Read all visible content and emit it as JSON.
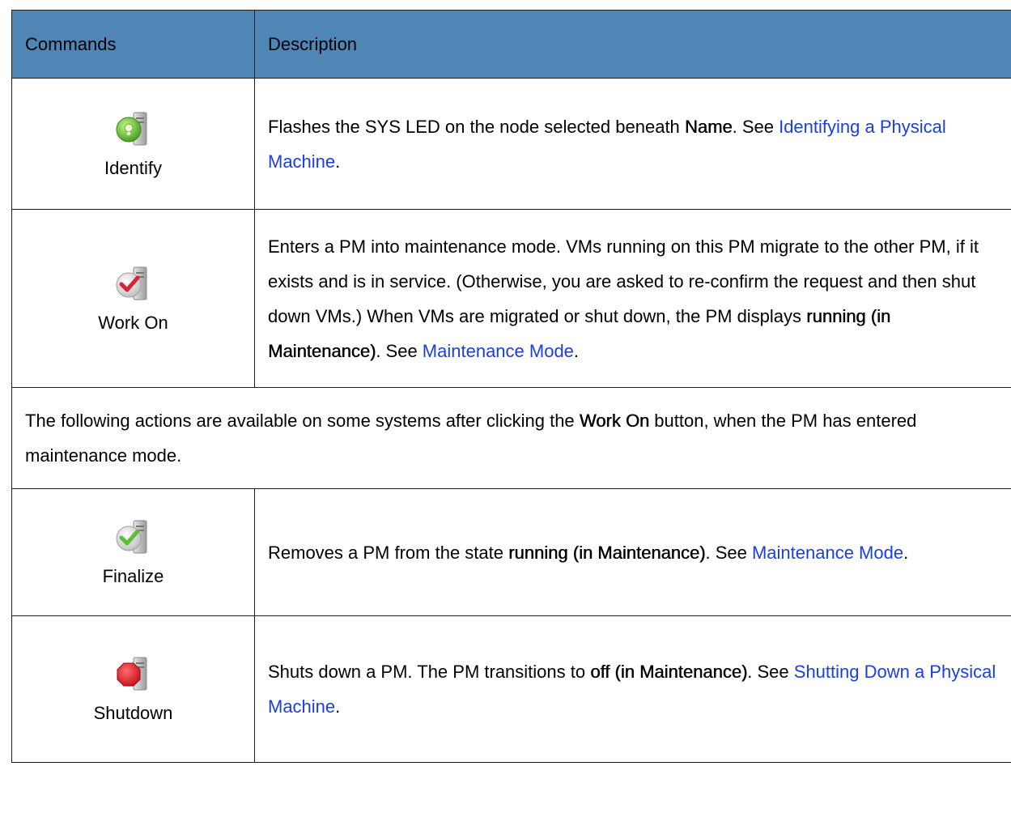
{
  "header": {
    "commands": "Commands",
    "description": "Description"
  },
  "rows": [
    {
      "command": "Identify",
      "icon": "identify-icon",
      "parts": [
        {
          "type": "text",
          "value": "Flashes the SYS LED on the node selected beneath "
        },
        {
          "type": "bold",
          "value": "Name"
        },
        {
          "type": "text",
          "value": ". See "
        },
        {
          "type": "link",
          "value": "Identifying a Physical Machine"
        },
        {
          "type": "text",
          "value": "."
        }
      ]
    },
    {
      "command": "Work On",
      "icon": "work-on-icon",
      "parts": [
        {
          "type": "text",
          "value": "Enters a PM into maintenance mode. VMs running on this PM migrate to the other PM, if it exists and is in service. (Otherwise, you are asked to re-confirm the request and then shut down VMs.) When VMs are migrated or shut down, the PM displays "
        },
        {
          "type": "bold",
          "value": "running (in Maintenance)"
        },
        {
          "type": "text",
          "value": ". See "
        },
        {
          "type": "link",
          "value": "Maintenance Mode"
        },
        {
          "type": "text",
          "value": "."
        }
      ]
    }
  ],
  "note": {
    "parts": [
      {
        "type": "text",
        "value": "The following actions are available on some systems after clicking the "
      },
      {
        "type": "bold",
        "value": "Work On"
      },
      {
        "type": "text",
        "value": " button, when the PM has entered maintenance mode."
      }
    ]
  },
  "rows_after": [
    {
      "command": "Finalize",
      "icon": "finalize-icon",
      "parts": [
        {
          "type": "text",
          "value": "Removes a PM from the state "
        },
        {
          "type": "bold",
          "value": "running (in Maintenance)"
        },
        {
          "type": "text",
          "value": ". See "
        },
        {
          "type": "link",
          "value": "Maintenance Mode"
        },
        {
          "type": "text",
          "value": "."
        }
      ]
    },
    {
      "command": "Shutdown",
      "icon": "shutdown-icon",
      "parts": [
        {
          "type": "text",
          "value": "Shuts down a PM. The PM transitions to "
        },
        {
          "type": "bold",
          "value": "off (in Maintenance)"
        },
        {
          "type": "text",
          "value": ". See "
        },
        {
          "type": "link",
          "value": "Shutting Down a Physical Machine"
        },
        {
          "type": "text",
          "value": "."
        }
      ]
    }
  ],
  "colors": {
    "header_bg": "#4f86b6",
    "link": "#1a3fe0",
    "border": "#1f1f1f"
  }
}
